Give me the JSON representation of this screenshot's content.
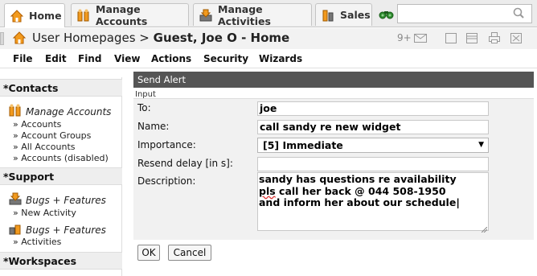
{
  "tabs": [
    {
      "label": "Home",
      "icon": "home-icon",
      "active": true
    },
    {
      "label": "Manage Accounts",
      "icon": "accounts-icon",
      "active": false
    },
    {
      "label": "Manage Activities",
      "icon": "activities-icon",
      "active": false
    },
    {
      "label": "Sales",
      "icon": "sales-icon",
      "active": false
    }
  ],
  "search": {
    "placeholder": "",
    "value": ""
  },
  "title": {
    "prefix": "User Homepages > ",
    "name": "Guest, Joe O - Home"
  },
  "title_badge": "9+",
  "menu": [
    "File",
    "Edit",
    "Find",
    "View",
    "Actions",
    "Security",
    "Wizards"
  ],
  "sidebar": {
    "contacts": {
      "title": "*Contacts",
      "main": "Manage Accounts",
      "subs": [
        "» Accounts",
        "» Account Groups",
        "» All Accounts",
        "» Accounts (disabled)"
      ]
    },
    "support": {
      "title": "*Support",
      "items": [
        {
          "main": "Bugs + Features",
          "sub": "» New Activity"
        },
        {
          "main": "Bugs + Features",
          "sub": "» Activities"
        }
      ]
    },
    "workspaces": {
      "title": "*Workspaces"
    }
  },
  "form": {
    "header": "Send Alert",
    "section": "Input",
    "to_label": "To:",
    "to_value": "joe",
    "name_label": "Name:",
    "name_value": "call sandy re new widget",
    "importance_label": "Importance:",
    "importance_value": "[5] Immediate",
    "resend_label": "Resend delay [in s]:",
    "resend_value": "",
    "description_label": "Description:",
    "description_line1": "sandy has questions re availability",
    "description_line2_word": "pls",
    "description_line2_rest": " call her back @ 044 508-1950",
    "description_line3": "and inform her about our schedule"
  },
  "buttons": {
    "ok": "OK",
    "cancel": "Cancel"
  },
  "colors": {
    "header_bg": "#555555",
    "accent_orange": "#f29a1e"
  }
}
